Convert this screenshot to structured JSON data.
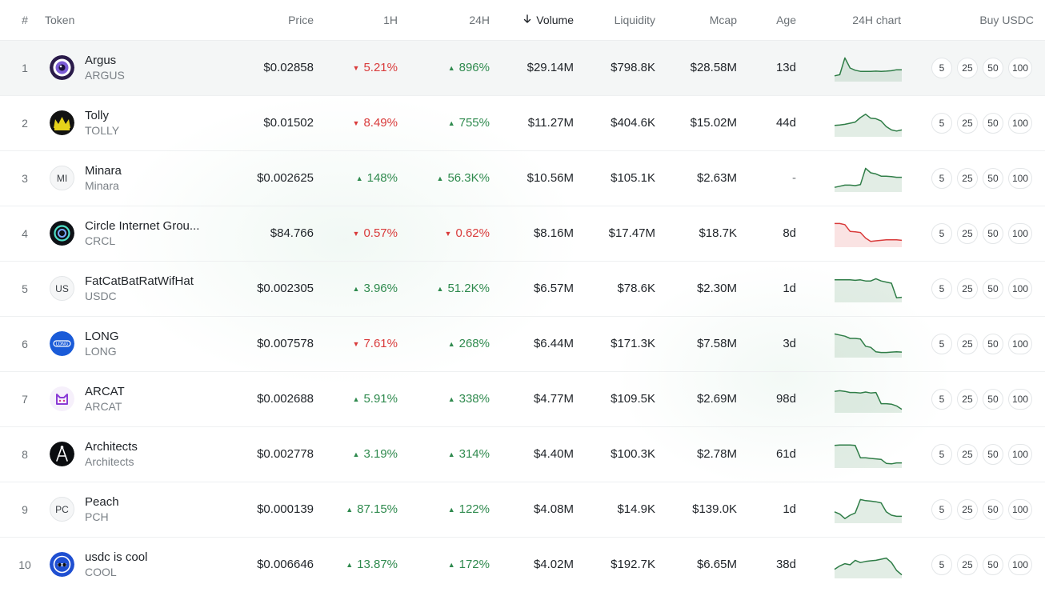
{
  "header": {
    "rank": "#",
    "token": "Token",
    "price": "Price",
    "h1": "1H",
    "h24": "24H",
    "volume": "Volume",
    "liquidity": "Liquidity",
    "mcap": "Mcap",
    "age": "Age",
    "chart": "24H chart",
    "buy": "Buy USDC"
  },
  "buy_amounts": [
    "5",
    "25",
    "50",
    "100"
  ],
  "colors": {
    "positive": "#2f8a4e",
    "negative": "#d93b3b"
  },
  "rows": [
    {
      "rank": "1",
      "name": "Argus",
      "symbol": "ARGUS",
      "icon": "argus-eye-logo",
      "price": "$0.02858",
      "h1": "5.21%",
      "h1_dir": "down",
      "h24": "896%",
      "h24_dir": "up",
      "volume": "$29.14M",
      "liquidity": "$798.8K",
      "mcap": "$28.58M",
      "age": "13d",
      "trend": "up",
      "spark": [
        0.15,
        0.2,
        0.95,
        0.5,
        0.4,
        0.35,
        0.35,
        0.35,
        0.36,
        0.35,
        0.36,
        0.38,
        0.42,
        0.42
      ]
    },
    {
      "rank": "2",
      "name": "Tolly",
      "symbol": "TOLLY",
      "icon": "tolly-crown-logo",
      "price": "$0.01502",
      "h1": "8.49%",
      "h1_dir": "down",
      "h24": "755%",
      "h24_dir": "up",
      "volume": "$11.27M",
      "liquidity": "$404.6K",
      "mcap": "$15.02M",
      "age": "44d",
      "trend": "up",
      "spark": [
        0.4,
        0.42,
        0.45,
        0.5,
        0.55,
        0.75,
        0.9,
        0.72,
        0.7,
        0.6,
        0.35,
        0.2,
        0.15,
        0.2
      ]
    },
    {
      "rank": "3",
      "name": "Minara",
      "symbol": "Minara",
      "icon": "initials-MI",
      "initials": "MI",
      "price": "$0.002625",
      "h1": "148%",
      "h1_dir": "up",
      "h24": "56.3K%",
      "h24_dir": "up",
      "volume": "$10.56M",
      "liquidity": "$105.1K",
      "mcap": "$2.63M",
      "age": "-",
      "trend": "up",
      "spark": [
        0.1,
        0.15,
        0.2,
        0.2,
        0.18,
        0.22,
        0.95,
        0.75,
        0.7,
        0.6,
        0.6,
        0.58,
        0.55,
        0.55
      ]
    },
    {
      "rank": "4",
      "name": "Circle Internet Grou...",
      "symbol": "CRCL",
      "icon": "circle-crcl-logo",
      "price": "$84.766",
      "h1": "0.57%",
      "h1_dir": "down",
      "h24": "0.62%",
      "h24_dir": "down",
      "volume": "$8.16M",
      "liquidity": "$17.47M",
      "mcap": "$18.7K",
      "age": "8d",
      "trend": "down",
      "spark": [
        0.95,
        0.95,
        0.9,
        0.6,
        0.58,
        0.55,
        0.3,
        0.15,
        0.18,
        0.2,
        0.22,
        0.22,
        0.22,
        0.2
      ]
    },
    {
      "rank": "5",
      "name": "FatCatBatRatWifHat",
      "symbol": "USDC",
      "icon": "initials-US",
      "initials": "US",
      "price": "$0.002305",
      "h1": "3.96%",
      "h1_dir": "up",
      "h24": "51.2K%",
      "h24_dir": "up",
      "volume": "$6.57M",
      "liquidity": "$78.6K",
      "mcap": "$2.30M",
      "age": "1d",
      "trend": "up",
      "spark": [
        0.9,
        0.9,
        0.9,
        0.9,
        0.88,
        0.9,
        0.85,
        0.85,
        0.95,
        0.85,
        0.8,
        0.75,
        0.1,
        0.12
      ]
    },
    {
      "rank": "6",
      "name": "LONG",
      "symbol": "LONG",
      "icon": "long-logo",
      "price": "$0.007578",
      "h1": "7.61%",
      "h1_dir": "down",
      "h24": "268%",
      "h24_dir": "up",
      "volume": "$6.44M",
      "liquidity": "$171.3K",
      "mcap": "$7.58M",
      "age": "3d",
      "trend": "up",
      "spark": [
        0.95,
        0.9,
        0.85,
        0.75,
        0.75,
        0.72,
        0.4,
        0.35,
        0.15,
        0.12,
        0.12,
        0.14,
        0.15,
        0.14
      ]
    },
    {
      "rank": "7",
      "name": "ARCAT",
      "symbol": "ARCAT",
      "icon": "arcat-cat-logo",
      "price": "$0.002688",
      "h1": "5.91%",
      "h1_dir": "up",
      "h24": "338%",
      "h24_dir": "up",
      "volume": "$4.77M",
      "liquidity": "$109.5K",
      "mcap": "$2.69M",
      "age": "98d",
      "trend": "up",
      "spark": [
        0.85,
        0.88,
        0.85,
        0.8,
        0.8,
        0.78,
        0.82,
        0.78,
        0.8,
        0.3,
        0.3,
        0.28,
        0.2,
        0.05
      ]
    },
    {
      "rank": "8",
      "name": "Architects",
      "symbol": "Architects",
      "icon": "architects-compass-logo",
      "price": "$0.002778",
      "h1": "3.19%",
      "h1_dir": "up",
      "h24": "314%",
      "h24_dir": "up",
      "volume": "$4.40M",
      "liquidity": "$100.3K",
      "mcap": "$2.78M",
      "age": "61d",
      "trend": "up",
      "spark": [
        0.9,
        0.92,
        0.92,
        0.92,
        0.9,
        0.35,
        0.35,
        0.32,
        0.3,
        0.28,
        0.1,
        0.08,
        0.12,
        0.12
      ]
    },
    {
      "rank": "9",
      "name": "Peach",
      "symbol": "PCH",
      "icon": "initials-PC",
      "initials": "PC",
      "price": "$0.000139",
      "h1": "87.15%",
      "h1_dir": "up",
      "h24": "122%",
      "h24_dir": "up",
      "volume": "$4.08M",
      "liquidity": "$14.9K",
      "mcap": "$139.0K",
      "age": "1d",
      "trend": "up",
      "spark": [
        0.4,
        0.3,
        0.1,
        0.25,
        0.35,
        0.95,
        0.9,
        0.88,
        0.85,
        0.8,
        0.4,
        0.25,
        0.2,
        0.2
      ]
    },
    {
      "rank": "10",
      "name": "usdc is cool",
      "symbol": "COOL",
      "icon": "usdc-cool-logo",
      "price": "$0.006646",
      "h1": "13.87%",
      "h1_dir": "up",
      "h24": "172%",
      "h24_dir": "up",
      "volume": "$4.02M",
      "liquidity": "$192.7K",
      "mcap": "$6.65M",
      "age": "38d",
      "trend": "up",
      "spark": [
        0.3,
        0.45,
        0.55,
        0.5,
        0.7,
        0.6,
        0.65,
        0.68,
        0.7,
        0.75,
        0.8,
        0.6,
        0.25,
        0.05
      ]
    }
  ]
}
